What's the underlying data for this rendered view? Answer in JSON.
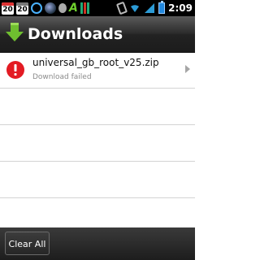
{
  "status_bar": {
    "calendar_1": "20",
    "calendar_2": "20",
    "time": "2:09",
    "icons": [
      "calendar-icon",
      "calendar-icon",
      "c-logo-icon",
      "swirl-icon",
      "drop-icon",
      "a-logo-icon",
      "bars-icon",
      "vibrate-icon",
      "wifi-icon",
      "signal-icon",
      "battery-icon"
    ]
  },
  "header": {
    "title": "Downloads",
    "icon": "download-arrow-icon",
    "accent": "#6fbf2f"
  },
  "downloads": [
    {
      "filename": "universal_gb_root_v25.zip",
      "status": "Download failed",
      "icon": "error-icon",
      "status_color": "#e31b23"
    }
  ],
  "footer": {
    "clear_all_label": "Clear All"
  }
}
